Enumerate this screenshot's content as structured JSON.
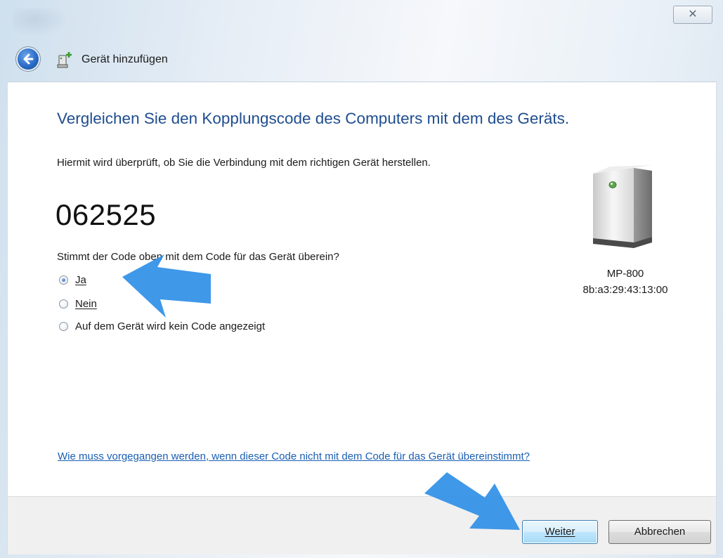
{
  "window": {
    "title": "Gerät hinzufügen",
    "close_symbol": "✕"
  },
  "main": {
    "heading": "Vergleichen Sie den Kopplungscode des Computers mit dem des Geräts.",
    "description": "Hiermit wird überprüft, ob Sie die Verbindung mit dem richtigen Gerät herstellen.",
    "code": "062525",
    "question": "Stimmt der Code oben mit dem Code für das Gerät überein?",
    "options": [
      {
        "label": "Ja",
        "checked": true
      },
      {
        "label": "Nein",
        "checked": false
      },
      {
        "label": "Auf dem Gerät wird kein Code angezeigt",
        "checked": false
      }
    ],
    "help_link": "Wie muss vorgegangen werden, wenn dieser Code nicht mit dem Code für das Gerät übereinstimmt?"
  },
  "device": {
    "name": "MP-800",
    "address": "8b:a3:29:43:13:00",
    "icon": "device-tower-icon"
  },
  "footer": {
    "next_label": "Weiter",
    "cancel_label": "Abbrechen"
  },
  "colors": {
    "heading": "#1f4d8f",
    "link": "#1a5fb4",
    "annotation_arrow": "#2f8fe6"
  }
}
